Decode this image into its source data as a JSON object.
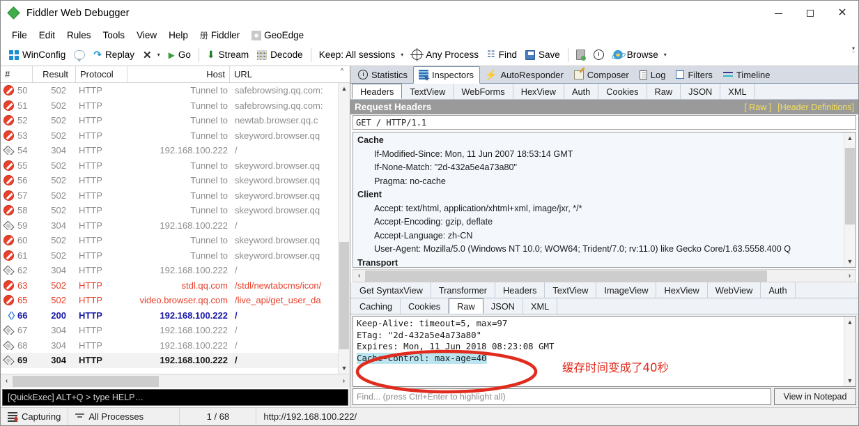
{
  "window": {
    "title": "Fiddler Web Debugger",
    "app_icon": "fiddler-diamond-icon",
    "minimize": "—",
    "maximize": "□",
    "close": "✕"
  },
  "menubar": {
    "items": [
      {
        "label": "File",
        "icon": null
      },
      {
        "label": "Edit",
        "icon": null
      },
      {
        "label": "Rules",
        "icon": null
      },
      {
        "label": "Tools",
        "icon": null
      },
      {
        "label": "View",
        "icon": null
      },
      {
        "label": "Help",
        "icon": null
      },
      {
        "label": "Fiddler",
        "icon": "fiddler-menu-icon"
      },
      {
        "label": "GeoEdge",
        "icon": "geoedge-icon"
      }
    ]
  },
  "toolbar": {
    "winconfig": "WinConfig",
    "comment_icon": "comment-bubble-icon",
    "replay": "Replay",
    "remove_caret": "▾",
    "go": "Go",
    "stream": "Stream",
    "decode": "Decode",
    "keep": "Keep: All sessions",
    "keep_caret": "▾",
    "any_process": "Any Process",
    "find": "Find",
    "save": "Save",
    "browse": "Browse",
    "browse_caret": "▾"
  },
  "sessions": {
    "columns": [
      "#",
      "Result",
      "Protocol",
      "Host",
      "URL"
    ],
    "rows": [
      {
        "icon": "block-icon",
        "num": "50",
        "result": "502",
        "protocol": "HTTP",
        "host": "Tunnel to",
        "url": "safebrowsing.qq.com:",
        "style": "gray"
      },
      {
        "icon": "block-icon",
        "num": "51",
        "result": "502",
        "protocol": "HTTP",
        "host": "Tunnel to",
        "url": "safebrowsing.qq.com:",
        "style": "gray"
      },
      {
        "icon": "block-icon",
        "num": "52",
        "result": "502",
        "protocol": "HTTP",
        "host": "Tunnel to",
        "url": "newtab.browser.qq.c",
        "style": "gray"
      },
      {
        "icon": "block-icon",
        "num": "53",
        "result": "502",
        "protocol": "HTTP",
        "host": "Tunnel to",
        "url": "skeyword.browser.qq",
        "style": "gray"
      },
      {
        "icon": "doc-icon",
        "num": "54",
        "result": "304",
        "protocol": "HTTP",
        "host": "192.168.100.222",
        "url": "/",
        "style": "gray"
      },
      {
        "icon": "block-icon",
        "num": "55",
        "result": "502",
        "protocol": "HTTP",
        "host": "Tunnel to",
        "url": "skeyword.browser.qq",
        "style": "gray"
      },
      {
        "icon": "block-icon",
        "num": "56",
        "result": "502",
        "protocol": "HTTP",
        "host": "Tunnel to",
        "url": "skeyword.browser.qq",
        "style": "gray"
      },
      {
        "icon": "block-icon",
        "num": "57",
        "result": "502",
        "protocol": "HTTP",
        "host": "Tunnel to",
        "url": "skeyword.browser.qq",
        "style": "gray"
      },
      {
        "icon": "block-icon",
        "num": "58",
        "result": "502",
        "protocol": "HTTP",
        "host": "Tunnel to",
        "url": "skeyword.browser.qq",
        "style": "gray"
      },
      {
        "icon": "doc-icon",
        "num": "59",
        "result": "304",
        "protocol": "HTTP",
        "host": "192.168.100.222",
        "url": "/",
        "style": "gray"
      },
      {
        "icon": "block-icon",
        "num": "60",
        "result": "502",
        "protocol": "HTTP",
        "host": "Tunnel to",
        "url": "skeyword.browser.qq",
        "style": "gray"
      },
      {
        "icon": "block-icon",
        "num": "61",
        "result": "502",
        "protocol": "HTTP",
        "host": "Tunnel to",
        "url": "skeyword.browser.qq",
        "style": "gray"
      },
      {
        "icon": "doc-icon",
        "num": "62",
        "result": "304",
        "protocol": "HTTP",
        "host": "192.168.100.222",
        "url": "/",
        "style": "gray"
      },
      {
        "icon": "block-icon",
        "num": "63",
        "result": "502",
        "protocol": "HTTP",
        "host": "stdl.qq.com",
        "url": "/stdl/newtabcms/icon/",
        "style": "red"
      },
      {
        "icon": "block-icon",
        "num": "65",
        "result": "502",
        "protocol": "HTTP",
        "host": "video.browser.qq.com",
        "url": "/live_api/get_user_da",
        "style": "red"
      },
      {
        "icon": "code-icon",
        "num": "66",
        "result": "200",
        "protocol": "HTTP",
        "host": "192.168.100.222",
        "url": "/",
        "style": "blue"
      },
      {
        "icon": "doc-icon",
        "num": "67",
        "result": "304",
        "protocol": "HTTP",
        "host": "192.168.100.222",
        "url": "/",
        "style": "gray"
      },
      {
        "icon": "doc-icon",
        "num": "68",
        "result": "304",
        "protocol": "HTTP",
        "host": "192.168.100.222",
        "url": "/",
        "style": "gray"
      },
      {
        "icon": "doc-icon",
        "num": "69",
        "result": "304",
        "protocol": "HTTP",
        "host": "192.168.100.222",
        "url": "/",
        "style": "black",
        "selected": true
      }
    ]
  },
  "quickexec": {
    "hint": "[QuickExec] ALT+Q > type HELP…"
  },
  "main_tabs": [
    {
      "label": "Statistics",
      "icon": "statistics-icon",
      "active": false
    },
    {
      "label": "Inspectors",
      "icon": "inspectors-icon",
      "active": true
    },
    {
      "label": "AutoResponder",
      "icon": "autoresponder-icon",
      "active": false
    },
    {
      "label": "Composer",
      "icon": "composer-icon",
      "active": false
    },
    {
      "label": "Log",
      "icon": "log-icon",
      "active": false
    },
    {
      "label": "Filters",
      "icon": "filters-icon",
      "active": false
    },
    {
      "label": "Timeline",
      "icon": "timeline-icon",
      "active": false
    }
  ],
  "request_tabs": [
    {
      "label": "Headers",
      "active": true
    },
    {
      "label": "TextView",
      "active": false
    },
    {
      "label": "WebForms",
      "active": false
    },
    {
      "label": "HexView",
      "active": false
    },
    {
      "label": "Auth",
      "active": false
    },
    {
      "label": "Cookies",
      "active": false
    },
    {
      "label": "Raw",
      "active": false
    },
    {
      "label": "JSON",
      "active": false
    },
    {
      "label": "XML",
      "active": false
    }
  ],
  "request_headers": {
    "title": "Request Headers",
    "raw_link": "[ Raw ]",
    "definitions_link": "[Header Definitions]",
    "request_line": "GET / HTTP/1.1",
    "groups": [
      {
        "name": "Cache",
        "entries": [
          "If-Modified-Since: Mon, 11 Jun 2007 18:53:14 GMT",
          "If-None-Match: \"2d-432a5e4a73a80\"",
          "Pragma: no-cache"
        ]
      },
      {
        "name": "Client",
        "entries": [
          "Accept: text/html, application/xhtml+xml, image/jxr, */*",
          "Accept-Encoding: gzip, deflate",
          "Accept-Language: zh-CN",
          "User-Agent: Mozilla/5.0 (Windows NT 10.0; WOW64; Trident/7.0; rv:11.0) like Gecko Core/1.63.5558.400 Q"
        ]
      },
      {
        "name": "Transport",
        "entries": []
      }
    ]
  },
  "response_tabs_row1": [
    {
      "label": "Get SyntaxView",
      "active": false
    },
    {
      "label": "Transformer",
      "active": false
    },
    {
      "label": "Headers",
      "active": false
    },
    {
      "label": "TextView",
      "active": false
    },
    {
      "label": "ImageView",
      "active": false
    },
    {
      "label": "HexView",
      "active": false
    },
    {
      "label": "WebView",
      "active": false
    },
    {
      "label": "Auth",
      "active": false
    }
  ],
  "response_tabs_row2": [
    {
      "label": "Caching",
      "active": false
    },
    {
      "label": "Cookies",
      "active": false
    },
    {
      "label": "Raw",
      "active": true
    },
    {
      "label": "JSON",
      "active": false
    },
    {
      "label": "XML",
      "active": false
    }
  ],
  "response_raw": {
    "lines": [
      {
        "text": "Keep-Alive: timeout=5, max=97",
        "highlight": false
      },
      {
        "text": "ETag: \"2d-432a5e4a73a80\"",
        "highlight": false
      },
      {
        "text": "Expires: Mon, 11 Jun 2018 08:23:08 GMT",
        "highlight": false
      },
      {
        "text": "Cache-Control: max-age=40",
        "highlight": true
      }
    ]
  },
  "find_bar": {
    "placeholder": "Find... (press Ctrl+Enter to highlight all)",
    "notepad_button": "View in Notepad"
  },
  "statusbar": {
    "capturing": "Capturing",
    "processes": "All Processes",
    "count": "1 / 68",
    "url": "http://192.168.100.222/"
  },
  "annotations": {
    "chinese_note": "缓存时间变成了40秒",
    "circle_color": "#e02b1d",
    "note_color": "#e02b1d"
  },
  "scroll": {
    "left_arrow": "‹",
    "right_arrow": "›",
    "up_arrow": "˄",
    "down_arrow": "˅"
  }
}
